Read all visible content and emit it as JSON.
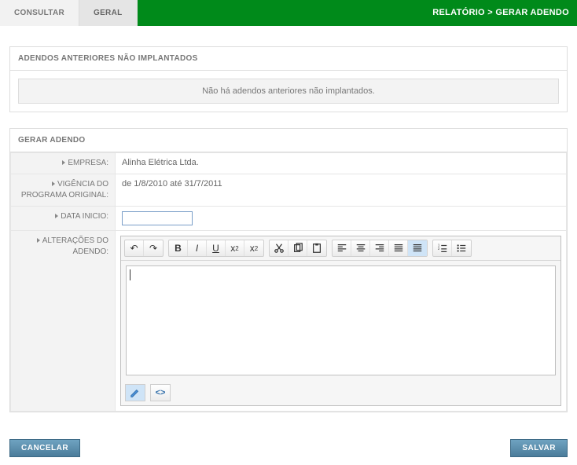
{
  "topbar": {
    "tabs": [
      {
        "label": "CONSULTAR"
      },
      {
        "label": "GERAL"
      }
    ],
    "breadcrumb": "RELATÓRIO > GERAR ADENDO"
  },
  "panel_prev": {
    "title": "ADENDOS ANTERIORES NÃO IMPLANTADOS",
    "empty_msg": "Não há adendos anteriores não implantados."
  },
  "panel_gen": {
    "title": "GERAR ADENDO",
    "fields": {
      "empresa": {
        "label": "EMPRESA:",
        "value": "Alinha Elétrica Ltda."
      },
      "vigencia": {
        "label": "VIGÊNCIA DO PROGRAMA ORIGINAL:",
        "value": "de 1/8/2010 até  31/7/2011"
      },
      "data_inicio": {
        "label": "DATA INICIO:",
        "value": ""
      },
      "alteracoes": {
        "label": "ALTERAÇÕES DO ADENDO:",
        "value": ""
      }
    }
  },
  "editor": {
    "icons": {
      "undo": "undo-icon",
      "redo": "redo-icon",
      "bold": "bold-icon",
      "italic": "italic-icon",
      "underline": "underline-icon",
      "subscript": "subscript-icon",
      "superscript": "superscript-icon",
      "cut": "cut-icon",
      "copy": "copy-icon",
      "paste": "paste-icon",
      "align_left": "align-left-icon",
      "align_center": "align-center-icon",
      "align_right": "align-right-icon",
      "justify": "justify-icon",
      "justify_highlight": "justify-highlighted-icon",
      "list_num": "ordered-list-icon",
      "list_bul": "unordered-list-icon",
      "design": "design-mode-icon",
      "source": "source-mode-icon"
    },
    "content": ""
  },
  "actions": {
    "cancel": "CANCELAR",
    "save": "SALVAR"
  }
}
